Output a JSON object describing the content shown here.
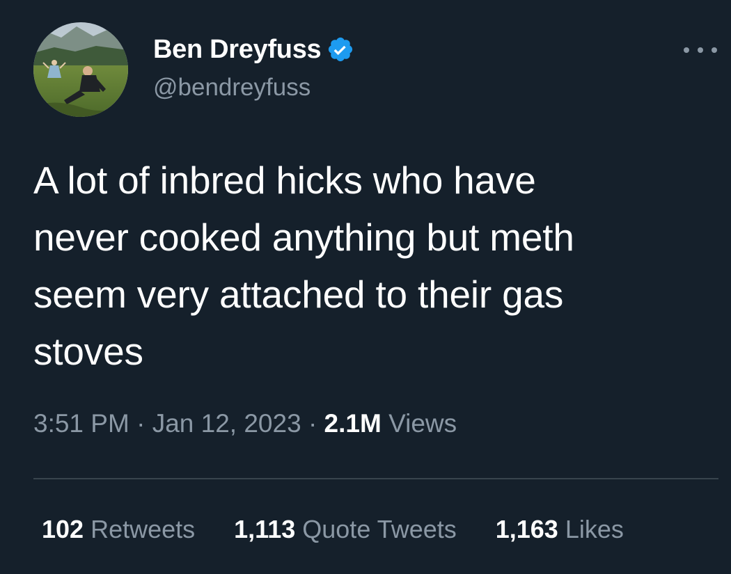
{
  "author": {
    "name": "Ben Dreyfuss",
    "handle": "@bendreyfuss",
    "verified": true,
    "verified_color": "#1d9bf0"
  },
  "tweet": {
    "text_lines": [
      "A lot of inbred hicks who have",
      "never cooked anything but meth",
      "seem very attached to their gas",
      "stoves"
    ]
  },
  "meta": {
    "time": "3:51 PM",
    "separator": "·",
    "date": "Jan 12, 2023",
    "views_count": "2.1M",
    "views_label": "Views"
  },
  "stats": [
    {
      "count": "102",
      "label": "Retweets"
    },
    {
      "count": "1,113",
      "label": "Quote Tweets"
    },
    {
      "count": "1,163",
      "label": "Likes"
    }
  ],
  "icons": {
    "more": "more-horizontal-icon",
    "verified": "verified-badge-icon"
  },
  "colors": {
    "background": "#15202b",
    "primary_text": "#ffffff",
    "secondary_text": "#8b98a5",
    "divider": "#38444d"
  }
}
